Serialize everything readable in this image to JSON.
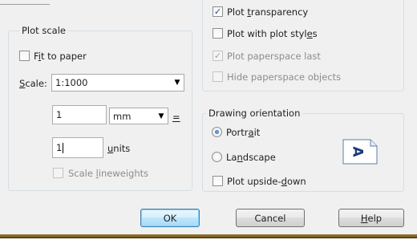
{
  "plot_scale": {
    "title": "Plot scale",
    "fit_to_paper": {
      "pre": "F",
      "ul": "i",
      "post": "t to paper",
      "checked": false
    },
    "scale_label": {
      "ul": "S",
      "post": "cale:"
    },
    "scale_value": "1:1000",
    "paper_value": "1",
    "paper_units": "mm",
    "equals": "=",
    "drawing_value": "1",
    "drawing_units": {
      "ul": "u",
      "post": "nits"
    },
    "scale_lineweights": {
      "pre": "Scale ",
      "ul": "l",
      "post": "ineweights",
      "checked": false,
      "enabled": false
    }
  },
  "plot_options": {
    "plot_transparency": {
      "pre": "Plot ",
      "ul": "t",
      "post": "ransparency",
      "checked": true
    },
    "plot_with_styles": {
      "pre": "Plot with plot styl",
      "ul": "e",
      "post": "s",
      "checked": false
    },
    "plot_paperspace_last": {
      "text": "Plot paperspace last",
      "checked": true,
      "enabled": false
    },
    "hide_paperspace": {
      "text": "Hide paperspace objects",
      "checked": false,
      "enabled": false
    }
  },
  "drawing_orientation": {
    "title": "Drawing orientation",
    "portrait": {
      "pre": "Portr",
      "ul": "a",
      "post": "it",
      "selected": true
    },
    "landscape": {
      "pre": "La",
      "ul": "n",
      "post": "dscape",
      "selected": false
    },
    "upside_down": {
      "pre": "Plot upside-",
      "ul": "d",
      "post": "own",
      "checked": false
    },
    "preview_glyph": "A"
  },
  "buttons": {
    "ok": "OK",
    "cancel": "Cancel",
    "help": {
      "ul": "H",
      "post": "elp"
    }
  },
  "colors": {
    "accent": "#3c7fb1",
    "taskbar": "#8a6d2a"
  }
}
